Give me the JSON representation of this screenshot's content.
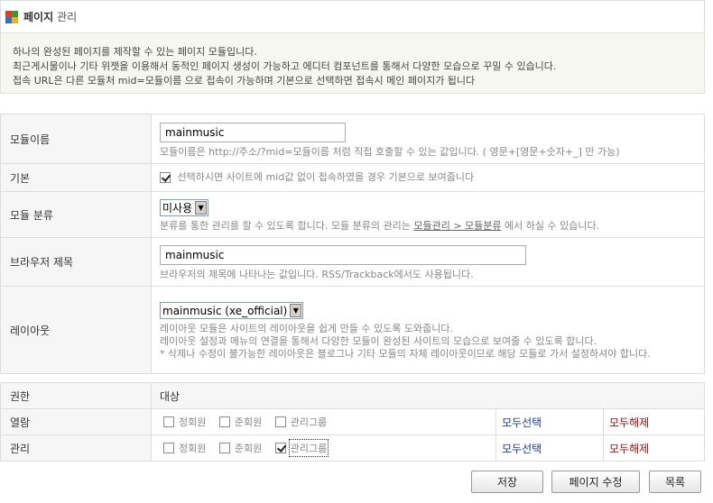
{
  "header": {
    "title_strong": "페이지",
    "title_sub": "관리",
    "logo_colors": [
      "#e23b2a",
      "#3a9a2c",
      "#2f6fd0",
      "#f2b21c"
    ]
  },
  "description": {
    "line1": "하나의 완성된 페이지를 제작할 수 있는 페이지 모듈입니다.",
    "line2": "최근게시물이나 기타 위젯을 이용해서 동적인 페이지 생성이 가능하고 에디터 컴포넌트를 통해서 다양한 모습으로 꾸밀 수 있습니다.",
    "line3": "접속 URL은 다른 모듈처 mid=모듈이름 으로 접속이 가능하며 기본으로 선택하면 접속시 메인 페이지가 됩니다"
  },
  "form": {
    "module_name": {
      "label": "모듈이름",
      "value": "mainmusic",
      "hint": "모듈이름은 http://주소/?mid=모듈이름 처럼 직접 호출할 수 있는 값입니다. ( 영문+[영문+숫자+_] 만 가능)"
    },
    "default": {
      "label": "기본",
      "checked": true,
      "hint": "선택하시면 사이트에 mid값 없이 접속하였을 경우 기본으로 보여줍니다"
    },
    "category": {
      "label": "모듈 분류",
      "selected": "미사용",
      "hint_before": "분류를 통한 관리를 할 수 있도록 합니다. 모듈 분류의 관리는",
      "hint_link": "모듈관리 > 모듈분류",
      "hint_after": "에서 하실 수 있습니다."
    },
    "browser_title": {
      "label": "브라우저 제목",
      "value": "mainmusic",
      "hint": "브라우저의 제목에 나타나는 값입니다. RSS/Trackback에서도 사용됩니다."
    },
    "layout": {
      "label": "레이아웃",
      "selected": "mainmusic (xe_official)",
      "hint1": "레이아웃 모듈은 사이트의 레이아웃을 쉽게 만들 수 있도록 도와줍니다.",
      "hint2": "레이아웃 설정과 메뉴의 연결을 통해서 다양한 모듈이 완성된 사이트의 모습으로 보여줄 수 있도록 합니다.",
      "hint3": "* 삭제나 수정이 불가능한 레이아웃은 블로그나 기타 모듈의 자체 레이아웃이므로 해당 모듈로 가서 설정하셔야 합니다."
    }
  },
  "permissions": {
    "header_label": "권한",
    "header_target": "대상",
    "groups": [
      "정회원",
      "준회원",
      "관리그룹"
    ],
    "select_all": "모두선택",
    "deselect_all": "모두해제",
    "rows": [
      {
        "label": "열람",
        "checked": [
          false,
          false,
          false
        ]
      },
      {
        "label": "관리",
        "checked": [
          false,
          false,
          true
        ]
      }
    ]
  },
  "buttons": {
    "save": "저장",
    "edit_page": "페이지 수정",
    "list": "목록"
  }
}
